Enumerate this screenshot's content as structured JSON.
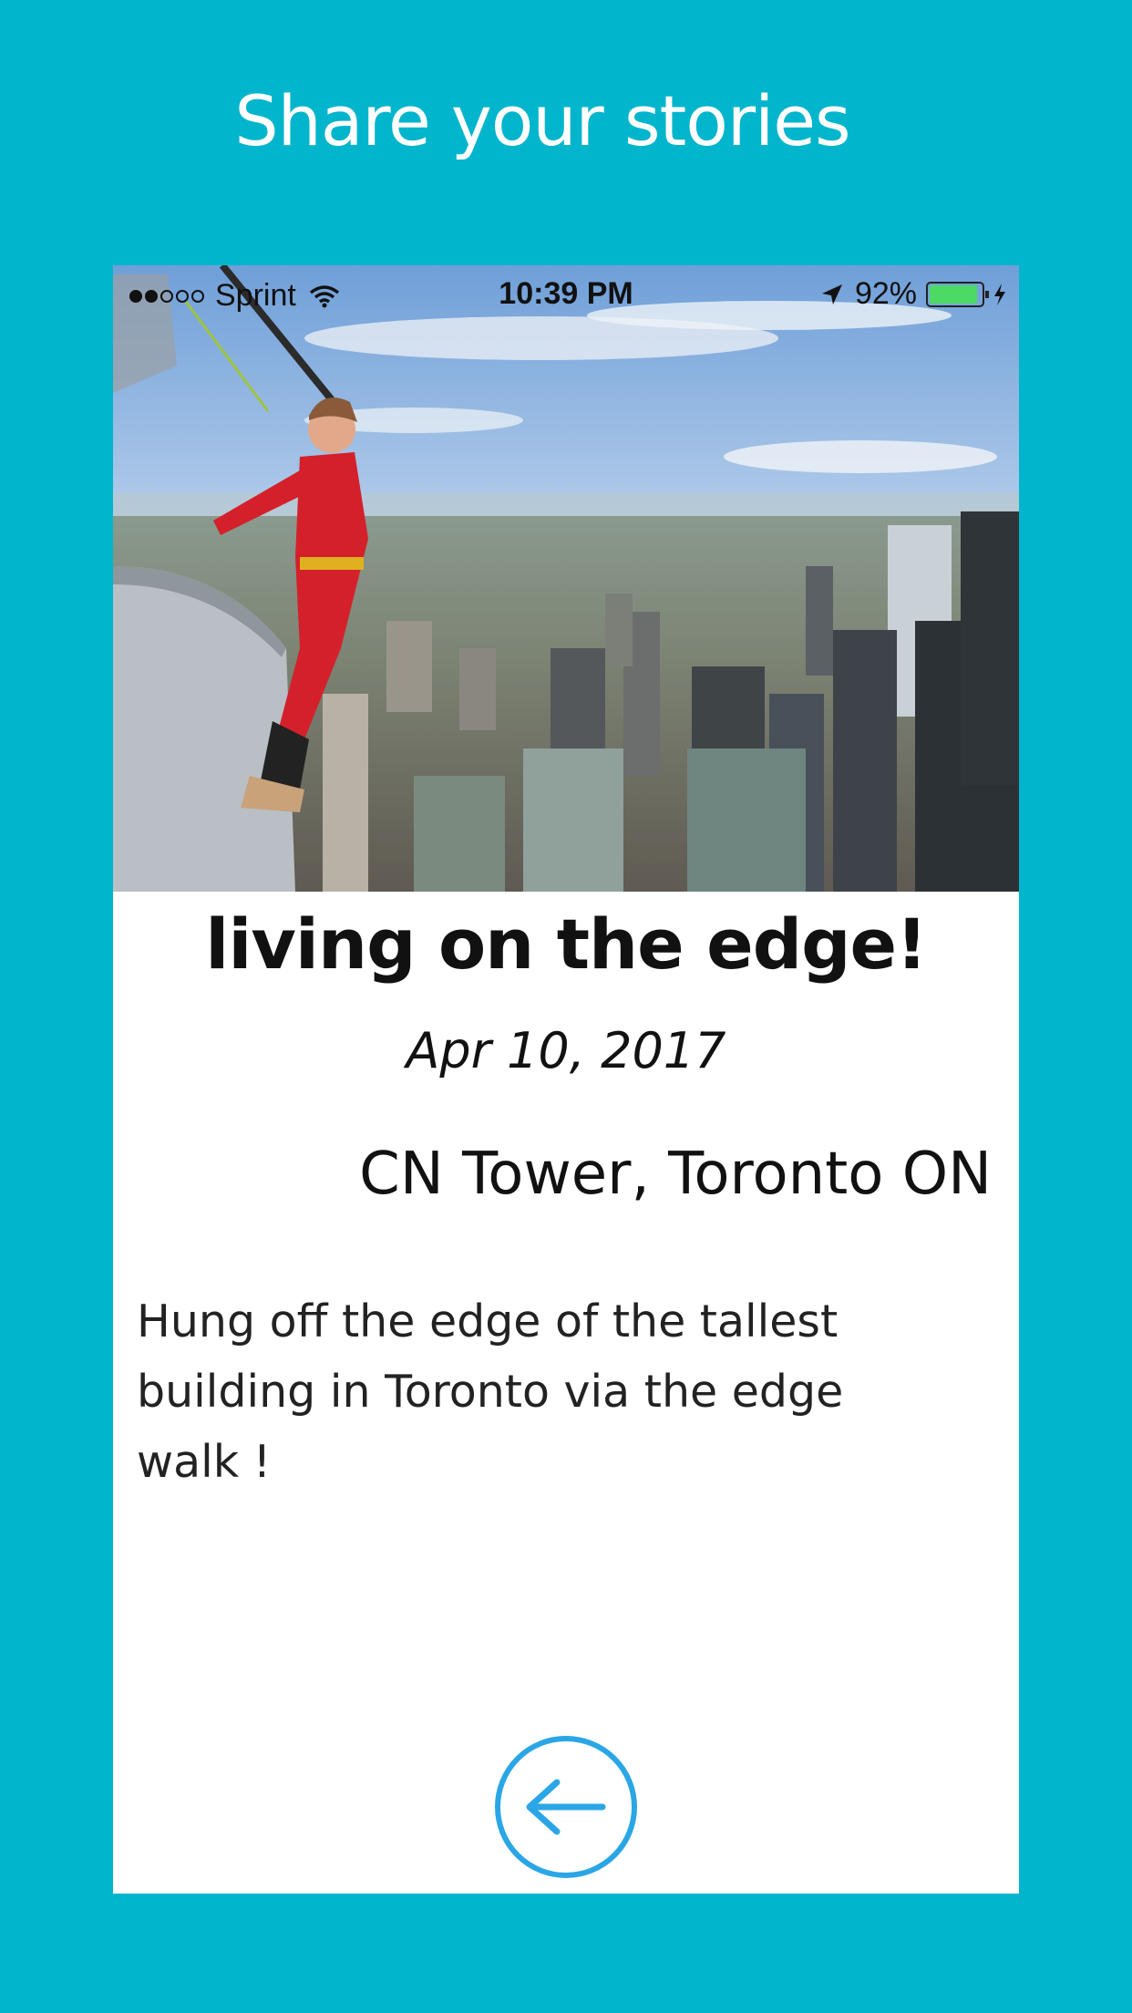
{
  "headline": "Share your stories",
  "status_bar": {
    "carrier": "Sprint",
    "signal_bars_filled": 2,
    "signal_bars_total": 5,
    "time": "10:39 PM",
    "battery_percent": "92%",
    "battery_level": 0.92
  },
  "story": {
    "title": "living on the edge!",
    "date": "Apr 10, 2017",
    "location": "CN Tower, Toronto ON",
    "description": "Hung off the edge of the tallest building in Toronto via the edge walk !"
  },
  "icons": {
    "back": "arrow-left-circle-icon",
    "wifi": "wifi-icon",
    "location": "location-arrow-icon",
    "charging": "bolt-icon"
  },
  "colors": {
    "background": "#00b5cc",
    "accent": "#2aa6e6",
    "battery": "#4cd964"
  }
}
